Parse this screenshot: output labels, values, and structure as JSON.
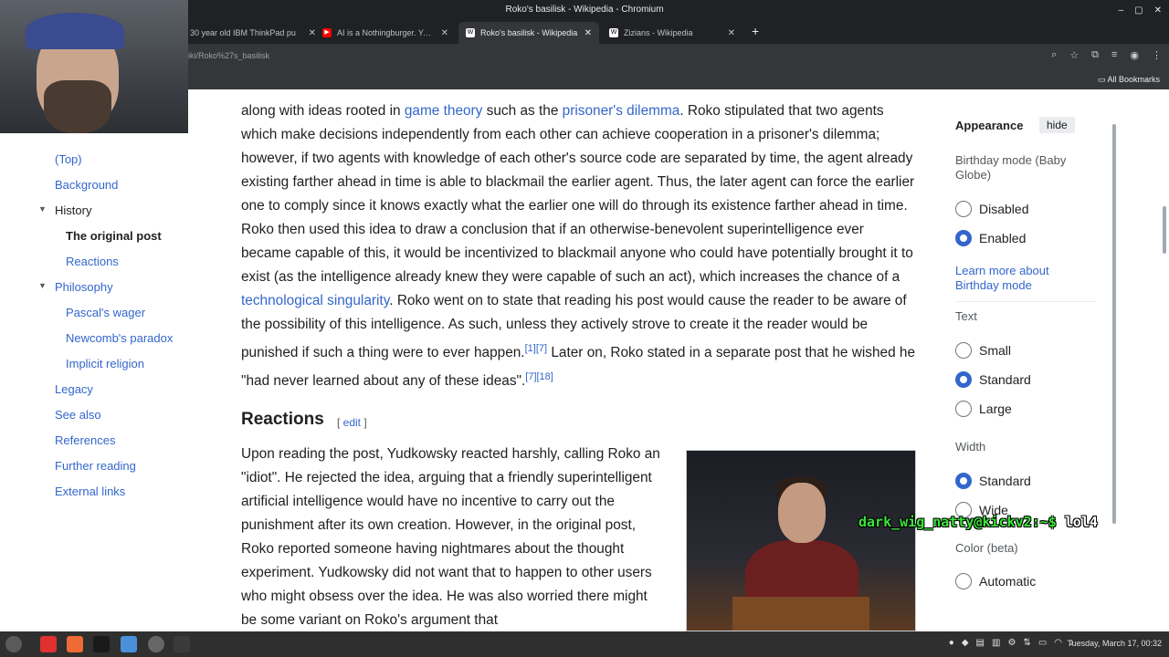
{
  "window": {
    "title": "Roko's basilisk - Wikipedia - Chromium"
  },
  "tabs": [
    {
      "title": "30 year old IBM ThinkPad pu"
    },
    {
      "title": "AI is a Nothingburger. You're"
    },
    {
      "title": "Roko's basilisk - Wikipedia"
    },
    {
      "title": "Zizians - Wikipedia"
    }
  ],
  "address": {
    "url": "iki/Roko%27s_basilisk"
  },
  "bookmarks": {
    "all_label": "All Bookmarks"
  },
  "toc": {
    "top": "(Top)",
    "background": "Background",
    "history": "History",
    "original_post": "The original post",
    "reactions": "Reactions",
    "philosophy": "Philosophy",
    "pascal": "Pascal's wager",
    "newcomb": "Newcomb's paradox",
    "implicit": "Implicit religion",
    "legacy": "Legacy",
    "see_also": "See also",
    "references": "References",
    "further": "Further reading",
    "external": "External links"
  },
  "article": {
    "p1a": "along with ideas rooted in ",
    "p1_link1": "game theory",
    "p1b": " such as the ",
    "p1_link2": "prisoner's dilemma",
    "p1c": ". Roko stipulated that two agents which make decisions independently from each other can achieve cooperation in a prisoner's dilemma; however, if two agents with knowledge of each other's source code are separated by time, the agent already existing farther ahead in time is able to blackmail the earlier agent. Thus, the later agent can force the earlier one to comply since it knows exactly what the earlier one will do through its existence farther ahead in time. Roko then used this idea to draw a conclusion that if an otherwise-benevolent superintelligence ever became capable of this, it would be incentivized to blackmail anyone who could have potentially brought it to exist (as the intelligence already knew they were capable of such an act), which increases the chance of a ",
    "p1_link3": "technological singularity",
    "p1d": ". Roko went on to state that reading his post would cause the reader to be aware of the possibility of this intelligence. As such, unless they actively strove to create it the reader would be punished if such a thing were to ever happen.",
    "p1_ref1": "[1][7]",
    "p1e": " Later on, Roko stated in a separate post that he wished he \"had never learned about any of these ideas\".",
    "p1_ref2": "[7][18]",
    "reactions_heading": "Reactions",
    "edit_label": "edit",
    "p2": "Upon reading the post, Yudkowsky reacted harshly, calling Roko an \"idiot\". He rejected the idea, arguing that a friendly superintelligent artificial intelligence would have no incentive to carry out the punishment after its own creation. However, in the original post, Roko reported someone having nightmares about the thought experiment. Yudkowsky did not want that to happen to other users who might obsess over the idea. He was also worried there might be some variant on Roko's argument that"
  },
  "appearance": {
    "title": "Appearance",
    "hide": "hide",
    "birthday_label": "Birthday mode (Baby Globe)",
    "disabled": "Disabled",
    "enabled": "Enabled",
    "learn_more": "Learn more about Birthday mode",
    "text_label": "Text",
    "small": "Small",
    "standard": "Standard",
    "large": "Large",
    "width_label": "Width",
    "width_standard": "Standard",
    "wide": "Wide",
    "color_label": "Color (beta)",
    "automatic": "Automatic"
  },
  "terminal_overlay": {
    "prompt": "dark_wig_natty@kickv2:~$",
    "command": "lol4"
  },
  "taskbar": {
    "clock": "Tuesday, March 17, 00:32"
  },
  "colors": {
    "link": "#3366cc",
    "chrome_dark": "#202124",
    "radio_selected": "#3366cc"
  }
}
